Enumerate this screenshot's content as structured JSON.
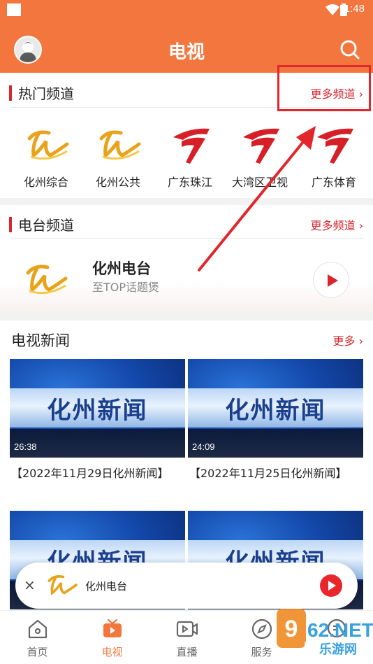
{
  "status_bar": {
    "time": "1:48"
  },
  "header": {
    "title": "电视"
  },
  "hot_channels": {
    "title": "热门频道",
    "more": "更多频道 ›",
    "items": [
      {
        "name": "化州综合",
        "logo": "hz-logo"
      },
      {
        "name": "化州公共",
        "logo": "hz-logo"
      },
      {
        "name": "广东珠江",
        "logo": "gdtv-logo"
      },
      {
        "name": "大湾区卫视",
        "logo": "gdtv-logo"
      },
      {
        "name": "广东体育",
        "logo": "gdtv-logo"
      }
    ]
  },
  "radio_channels": {
    "title": "电台频道",
    "more": "更多频道 ›",
    "item": {
      "name": "化州电台",
      "subtitle": "至TOP话题煲"
    }
  },
  "tv_news": {
    "title": "电视新闻",
    "more": "更多 ›",
    "thumb_text": "化州新闻",
    "cards": [
      {
        "duration": "26:38",
        "caption": "【2022年11月29日化州新闻】"
      },
      {
        "duration": "24:09",
        "caption": "【2022年11月25日化州新闻】"
      },
      {
        "duration": "",
        "caption": ""
      },
      {
        "duration": "",
        "caption": ""
      }
    ]
  },
  "mini_player": {
    "name": "化州电台",
    "close": "×"
  },
  "bottom_nav": [
    {
      "label": "首页",
      "icon": "home-icon"
    },
    {
      "label": "电视",
      "icon": "tv-icon",
      "active": true
    },
    {
      "label": "直播",
      "icon": "live-icon"
    },
    {
      "label": "服务",
      "icon": "compass-icon"
    },
    {
      "label": "",
      "icon": "chat-icon"
    }
  ],
  "watermark": {
    "line1": "962.NET",
    "line2": "乐游网"
  },
  "colors": {
    "brand": "#F2763D",
    "accent_red": "#D8262C",
    "annotation": "#E1262C"
  }
}
